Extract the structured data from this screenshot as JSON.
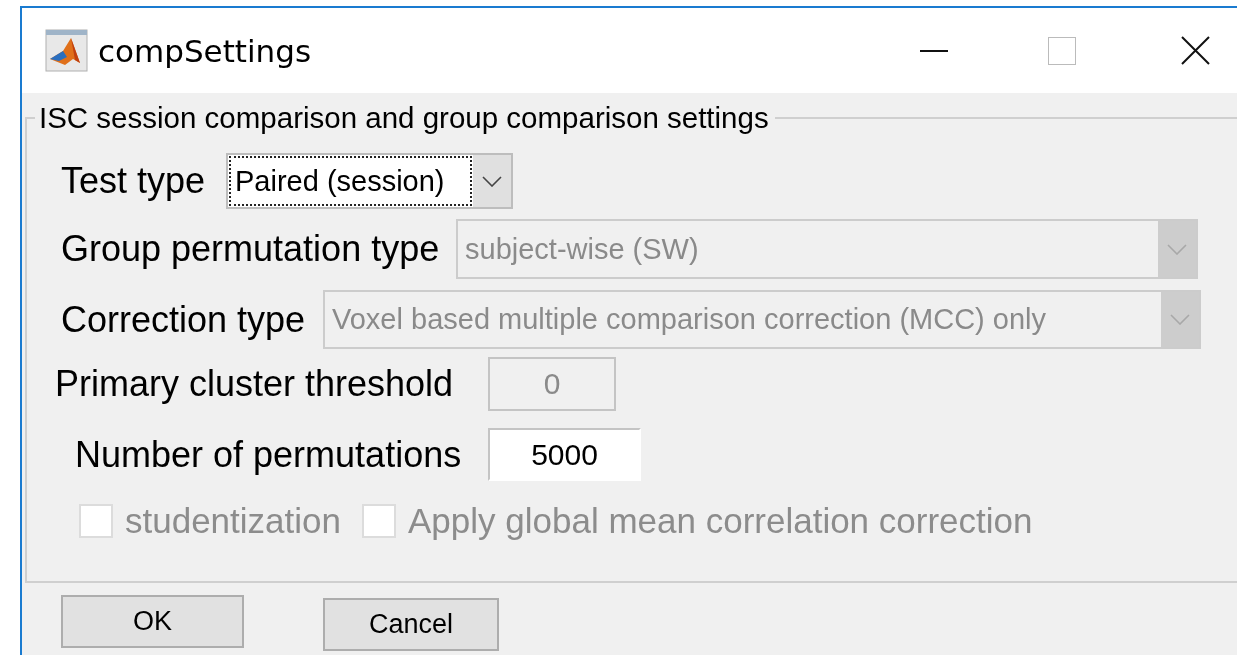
{
  "window": {
    "title": "compSettings"
  },
  "group": {
    "title": "ISC session comparison and group comparison settings",
    "rows": [
      {
        "kind": "dropdown",
        "label": "Test type",
        "value": "Paired (session)",
        "disabled": false,
        "focused": true
      },
      {
        "kind": "dropdown",
        "label": "Group permutation type",
        "value": "subject-wise (SW)",
        "disabled": true,
        "focused": false
      },
      {
        "kind": "dropdown",
        "label": "Correction type",
        "value": "Voxel based multiple comparison correction (MCC) only",
        "disabled": true,
        "focused": false
      },
      {
        "kind": "field",
        "label": "Primary cluster threshold",
        "value": "0",
        "disabled": true
      },
      {
        "kind": "field",
        "label": "Number of permutations",
        "value": "5000",
        "disabled": false
      },
      {
        "kind": "checkboxes",
        "items": [
          {
            "label": "studentization",
            "checked": false,
            "disabled": true
          },
          {
            "label": "Apply global mean correlation correction",
            "checked": false,
            "disabled": true
          }
        ]
      }
    ]
  },
  "buttons": [
    {
      "label": "OK"
    },
    {
      "label": "Cancel"
    }
  ]
}
